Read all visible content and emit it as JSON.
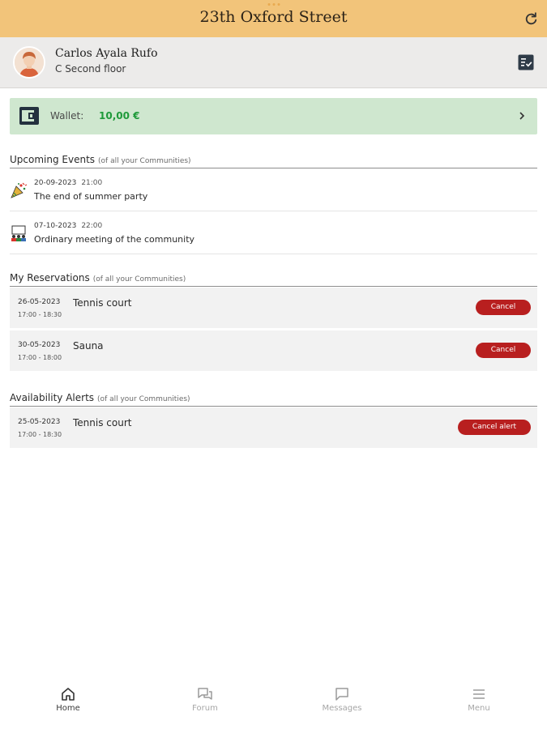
{
  "header": {
    "title": "23th Oxford Street"
  },
  "profile": {
    "name": "Carlos Ayala Rufo",
    "unit": "C Second floor"
  },
  "wallet": {
    "label": "Wallet:",
    "value": "10,00 €"
  },
  "events_section": {
    "title": "Upcoming Events",
    "subtitle": "(of all your Communities)"
  },
  "events": [
    {
      "date": "20-09-2023",
      "time": "21:00",
      "title": "The end of summer party",
      "icon": "party-icon"
    },
    {
      "date": "07-10-2023",
      "time": "22:00",
      "title": "Ordinary meeting of the community",
      "icon": "meeting-icon"
    }
  ],
  "reservations_section": {
    "title": "My Reservations",
    "subtitle": "(of all your Communities)"
  },
  "reservations": [
    {
      "date": "26-05-2023",
      "time": "17:00 - 18:30",
      "name": "Tennis court",
      "action": "Cancel"
    },
    {
      "date": "30-05-2023",
      "time": "17:00 - 18:00",
      "name": "Sauna",
      "action": "Cancel"
    }
  ],
  "alerts_section": {
    "title": "Availability Alerts",
    "subtitle": "(of all your Communities)"
  },
  "alerts": [
    {
      "date": "25-05-2023",
      "time": "17:00 - 18:30",
      "name": "Tennis court",
      "action": "Cancel alert"
    }
  ],
  "tabs": [
    {
      "label": "Home",
      "icon": "home-icon",
      "active": true
    },
    {
      "label": "Forum",
      "icon": "forum-icon",
      "active": false
    },
    {
      "label": "Messages",
      "icon": "messages-icon",
      "active": false
    },
    {
      "label": "Menu",
      "icon": "menu-icon",
      "active": false
    }
  ],
  "colors": {
    "header": "#f2c47a",
    "wallet_bg": "#cfe7cf",
    "wallet_value": "#1f9a3a",
    "danger": "#b81f1f"
  }
}
